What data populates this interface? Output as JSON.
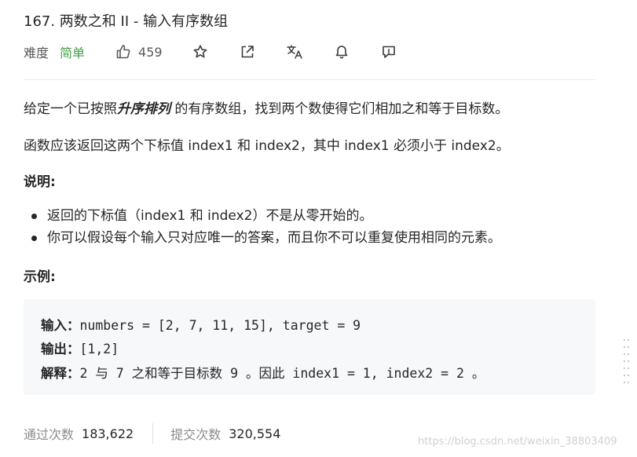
{
  "problem": {
    "title": "167. 两数之和 II - 输入有序数组",
    "difficulty_label": "难度",
    "difficulty": "简单",
    "likes": "459"
  },
  "description": {
    "p1_before": "给定一个已按照",
    "p1_emphasis": "升序排列",
    "p1_after": " 的有序数组，找到两个数使得它们相加之和等于目标数。",
    "p2": "函数应该返回这两个下标值 index1 和 index2，其中 index1 必须小于 index2。",
    "notes_heading": "说明:",
    "notes": [
      "返回的下标值（index1 和 index2）不是从零开始的。",
      "你可以假设每个输入只对应唯一的答案，而且你不可以重复使用相同的元素。"
    ],
    "example_heading": "示例:"
  },
  "example": {
    "input_label": "输入：",
    "input_value": "numbers = [2, 7, 11, 15], target = 9",
    "output_label": "输出：",
    "output_value": "[1,2]",
    "explain_label": "解释：",
    "explain_value": "2 与 7 之和等于目标数 9 。因此 index1 = 1, index2 = 2 。"
  },
  "stats": {
    "accepted_label": "通过次数",
    "accepted_value": "183,622",
    "submitted_label": "提交次数",
    "submitted_value": "320,554"
  },
  "watermark": "https://blog.csdn.net/weixin_38803409",
  "icons": [
    "thumbs-up-icon",
    "star-icon",
    "share-icon",
    "translate-icon",
    "bell-icon",
    "feedback-icon"
  ],
  "colors": {
    "easy": "#43a047",
    "text": "#262626",
    "muted": "#8c8c8c",
    "code_bg": "#f7f8fa"
  }
}
